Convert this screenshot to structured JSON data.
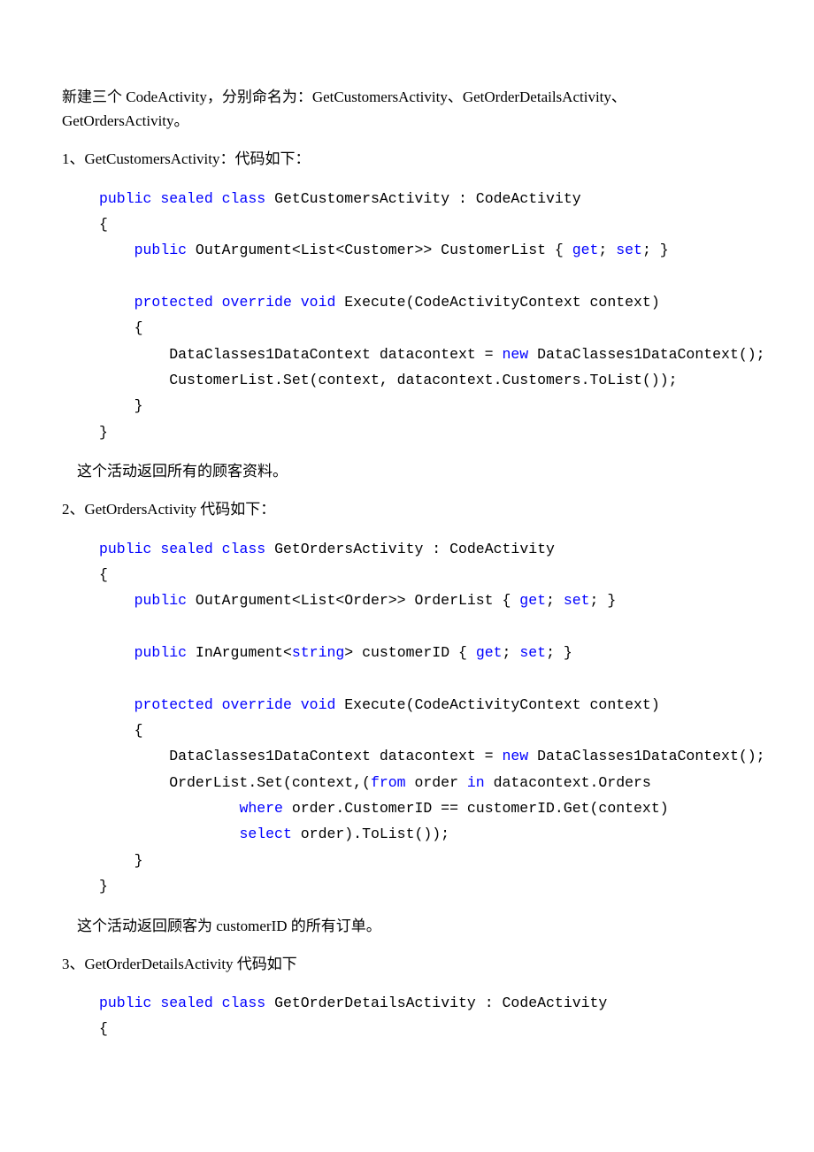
{
  "intro": "  新建三个 CodeActivity，分别命名为：GetCustomersActivity、GetOrderDetailsActivity、GetOrdersActivity。",
  "s1": {
    "heading": "1、GetCustomersActivity：代码如下：",
    "code": {
      "l1a": "public",
      "l1b": "sealed",
      "l1c": "class",
      "l1d": " GetCustomersActivity : CodeActivity",
      "l2": "{",
      "l3a": "    ",
      "l3b": "public",
      "l3c": " OutArgument<List<Customer>> CustomerList { ",
      "l3d": "get",
      "l3e": "; ",
      "l3f": "set",
      "l3g": "; }",
      "l4": "",
      "l5a": "    ",
      "l5b": "protected",
      "l5c": " ",
      "l5d": "override",
      "l5e": " ",
      "l5f": "void",
      "l5g": " Execute(CodeActivityContext context)",
      "l6": "    {",
      "l7a": "        DataClasses1DataContext datacontext = ",
      "l7b": "new",
      "l7c": " DataClasses1DataContext();",
      "l8": "        CustomerList.Set(context, datacontext.Customers.ToList());",
      "l9": "    }",
      "l10": "}"
    },
    "after": "这个活动返回所有的顾客资料。"
  },
  "s2": {
    "heading": "2、GetOrdersActivity 代码如下：",
    "code": {
      "l1a": "public",
      "l1b": "sealed",
      "l1c": "class",
      "l1d": " GetOrdersActivity : CodeActivity",
      "l2": "{",
      "l3a": "    ",
      "l3b": "public",
      "l3c": " OutArgument<List<Order>> OrderList { ",
      "l3d": "get",
      "l3e": "; ",
      "l3f": "set",
      "l3g": "; }",
      "l4": "",
      "l5a": "    ",
      "l5b": "public",
      "l5c": " InArgument<",
      "l5d": "string",
      "l5e": "> customerID { ",
      "l5f": "get",
      "l5g": "; ",
      "l5h": "set",
      "l5i": "; }",
      "l6": "",
      "l7a": "    ",
      "l7b": "protected",
      "l7c": " ",
      "l7d": "override",
      "l7e": " ",
      "l7f": "void",
      "l7g": " Execute(CodeActivityContext context)",
      "l8": "    {",
      "l9a": "        DataClasses1DataContext datacontext = ",
      "l9b": "new",
      "l9c": " DataClasses1DataContext();",
      "l10a": "        OrderList.Set(context,(",
      "l10b": "from",
      "l10c": " order ",
      "l10d": "in",
      "l10e": " datacontext.Orders",
      "l11a": "                ",
      "l11b": "where",
      "l11c": " order.CustomerID == customerID.Get(context)",
      "l12a": "                ",
      "l12b": "select",
      "l12c": " order).ToList());",
      "l13": "    }",
      "l14": "}"
    },
    "after": "这个活动返回顾客为 customerID 的所有订单。"
  },
  "s3": {
    "heading": "3、GetOrderDetailsActivity 代码如下",
    "code": {
      "l1a": "public",
      "l1b": "sealed",
      "l1c": "class",
      "l1d": " GetOrderDetailsActivity : CodeActivity",
      "l2": "{"
    }
  }
}
